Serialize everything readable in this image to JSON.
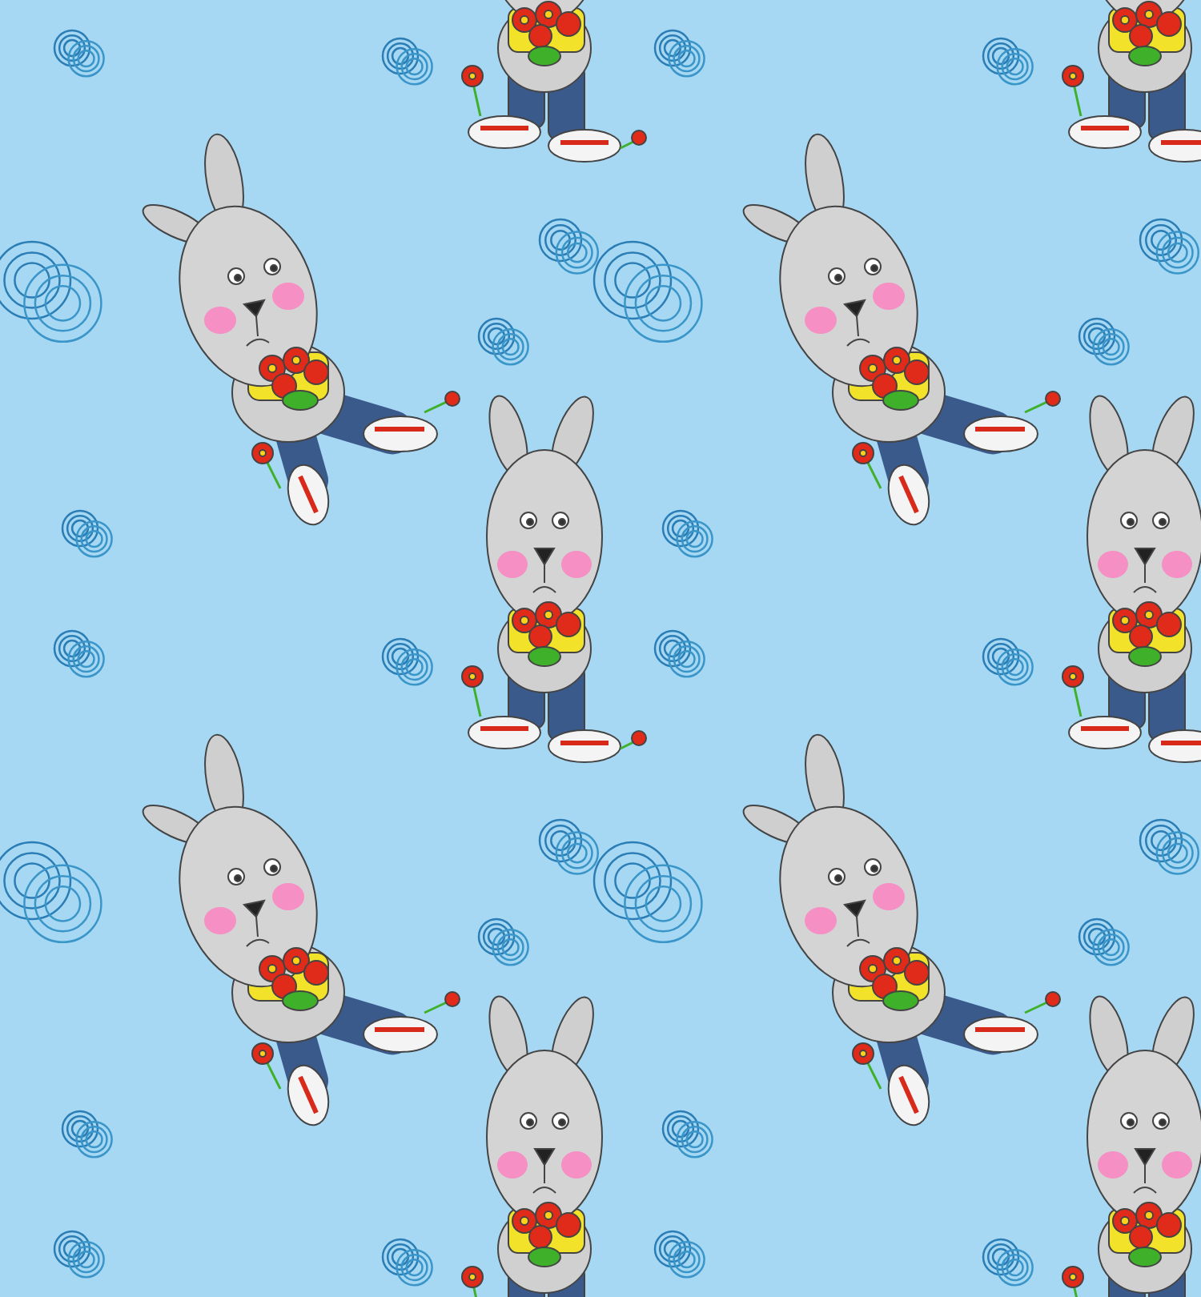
{
  "background": {
    "kind": "rings"
  },
  "motifs": [
    {
      "kind": "sitting"
    },
    {
      "kind": "standing"
    }
  ]
}
